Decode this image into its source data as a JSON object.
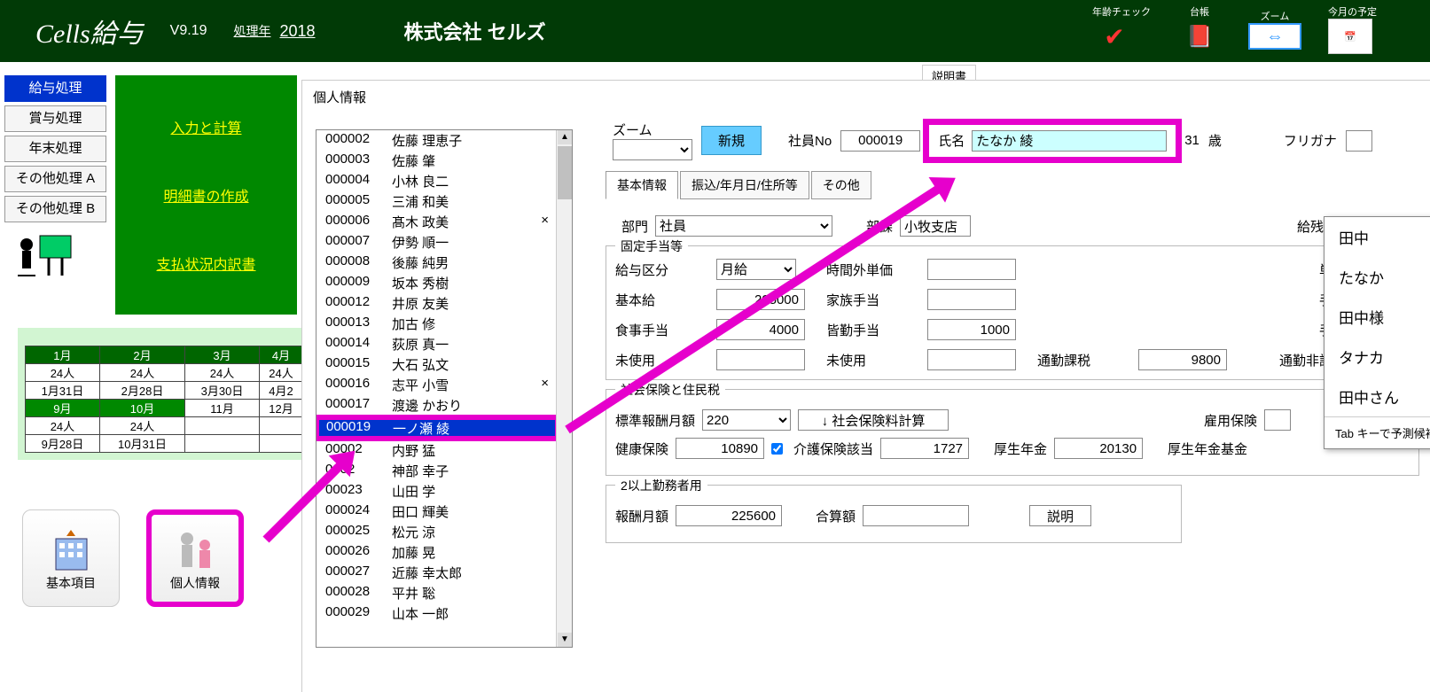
{
  "header": {
    "app_title": "Cells給与",
    "version": "V9.19",
    "year_label": "処理年",
    "year_value": "2018",
    "company": "株式会社 セルズ",
    "icons": {
      "age_check": "年齢チェック",
      "ledger": "台帳",
      "zoom": "ズーム",
      "schedule": "今月の予定"
    },
    "expl": "説明書"
  },
  "left_nav": {
    "salary": "給与処理",
    "bonus": "賞与処理",
    "yearend": "年末処理",
    "other_a": "その他処理 A",
    "other_b": "その他処理 B"
  },
  "green_panel": {
    "input_calc": "入力と計算",
    "detail": "明細書の作成",
    "payment": "支払状況内訳書"
  },
  "month_grid": {
    "row1": [
      "1月",
      "2月",
      "3月",
      "4月"
    ],
    "row2": [
      "24人",
      "24人",
      "24人",
      "24人"
    ],
    "row3": [
      "1月31日",
      "2月28日",
      "3月30日",
      "4月2"
    ],
    "row4": [
      "9月",
      "10月",
      "11月",
      "12月"
    ],
    "row5": [
      "24人",
      "24人",
      "",
      ""
    ],
    "row6": [
      "9月28日",
      "10月31日",
      "",
      ""
    ]
  },
  "bottom_buttons": {
    "basic": "基本項目",
    "personal": "個人情報"
  },
  "form": {
    "title": "個人情報",
    "zoom_label": "ズーム",
    "new_btn": "新規",
    "emp_no_label": "社員No",
    "emp_no": "000019",
    "name_label": "氏名",
    "name_value": "たなか 綾",
    "age": "31",
    "age_suffix": "歳",
    "furigana_label": "フリガナ",
    "tabs": {
      "basic": "基本情報",
      "transfer": "振込/年月日/住所等",
      "other": "その他"
    },
    "dept_label": "部門",
    "dept_value": "社員",
    "section_label": "部課",
    "section_value": "小牧支店",
    "remaining_label": "給残日",
    "fixed_allow": {
      "title": "固定手当等",
      "pay_type_label": "給与区分",
      "pay_type": "月給",
      "overtime_label": "時間外単価",
      "unit_label": "単価",
      "basic_label": "基本給",
      "basic": "205000",
      "family_label": "家族手当",
      "allow_label": "手当",
      "meal_label": "食事手当",
      "meal": "4000",
      "attendance_label": "皆勤手当",
      "attendance": "1000",
      "unused_label": "未使用",
      "commute_tax_label": "通勤課税",
      "commute_tax": "9800",
      "commute_notax_label": "通勤非課税"
    },
    "insurance": {
      "title": "社会保険と住民税",
      "std_monthly_label": "標準報酬月額",
      "std_monthly": "220",
      "calc_btn": "↓ 社会保険料計算",
      "emp_ins_label": "雇用保険",
      "health_label": "健康保険",
      "health": "10890",
      "care_check_label": "介護保険該当",
      "care": "1727",
      "pension_label": "厚生年金",
      "pension": "20130",
      "pension_fund_label": "厚生年金基金"
    },
    "multi_work": {
      "title": "2以上勤務者用",
      "monthly_label": "報酬月額",
      "monthly": "225600",
      "total_label": "合算額",
      "explain_btn": "説明"
    }
  },
  "emp_list": [
    {
      "code": "000002",
      "name": "佐藤 理恵子"
    },
    {
      "code": "000003",
      "name": "佐藤 肇"
    },
    {
      "code": "000004",
      "name": "小林 良二"
    },
    {
      "code": "000005",
      "name": "三浦 和美"
    },
    {
      "code": "000006",
      "name": "髙木 政美",
      "mark": "×"
    },
    {
      "code": "000007",
      "name": "伊勢 順一"
    },
    {
      "code": "000008",
      "name": "後藤 純男"
    },
    {
      "code": "000009",
      "name": "坂本 秀樹"
    },
    {
      "code": "000012",
      "name": "井原 友美"
    },
    {
      "code": "000013",
      "name": "加古 修"
    },
    {
      "code": "000014",
      "name": "荻原 真一"
    },
    {
      "code": "000015",
      "name": "大石 弘文"
    },
    {
      "code": "000016",
      "name": "志平 小雪",
      "mark": "×"
    },
    {
      "code": "000017",
      "name": "渡邊 かおり"
    },
    {
      "code": "",
      "name": ""
    },
    {
      "code": "000019",
      "name": "一ノ瀬 綾",
      "selected": true
    },
    {
      "code": "",
      "name": ""
    },
    {
      "code": "00002",
      "name": "内野 猛"
    },
    {
      "code": "0002",
      "name": "神部 幸子"
    },
    {
      "code": "00023",
      "name": "山田 学"
    },
    {
      "code": "000024",
      "name": "田口 輝美"
    },
    {
      "code": "000025",
      "name": "松元 涼"
    },
    {
      "code": "000026",
      "name": "加藤 晃"
    },
    {
      "code": "000027",
      "name": "近藤 幸太郎"
    },
    {
      "code": "000028",
      "name": "平井 聡"
    },
    {
      "code": "000029",
      "name": "山本 一郎"
    }
  ],
  "ime": {
    "options": [
      "田中",
      "たなか",
      "田中様",
      "タナカ",
      "田中さん"
    ],
    "footer": "Tab キーで予測候補を選択"
  }
}
